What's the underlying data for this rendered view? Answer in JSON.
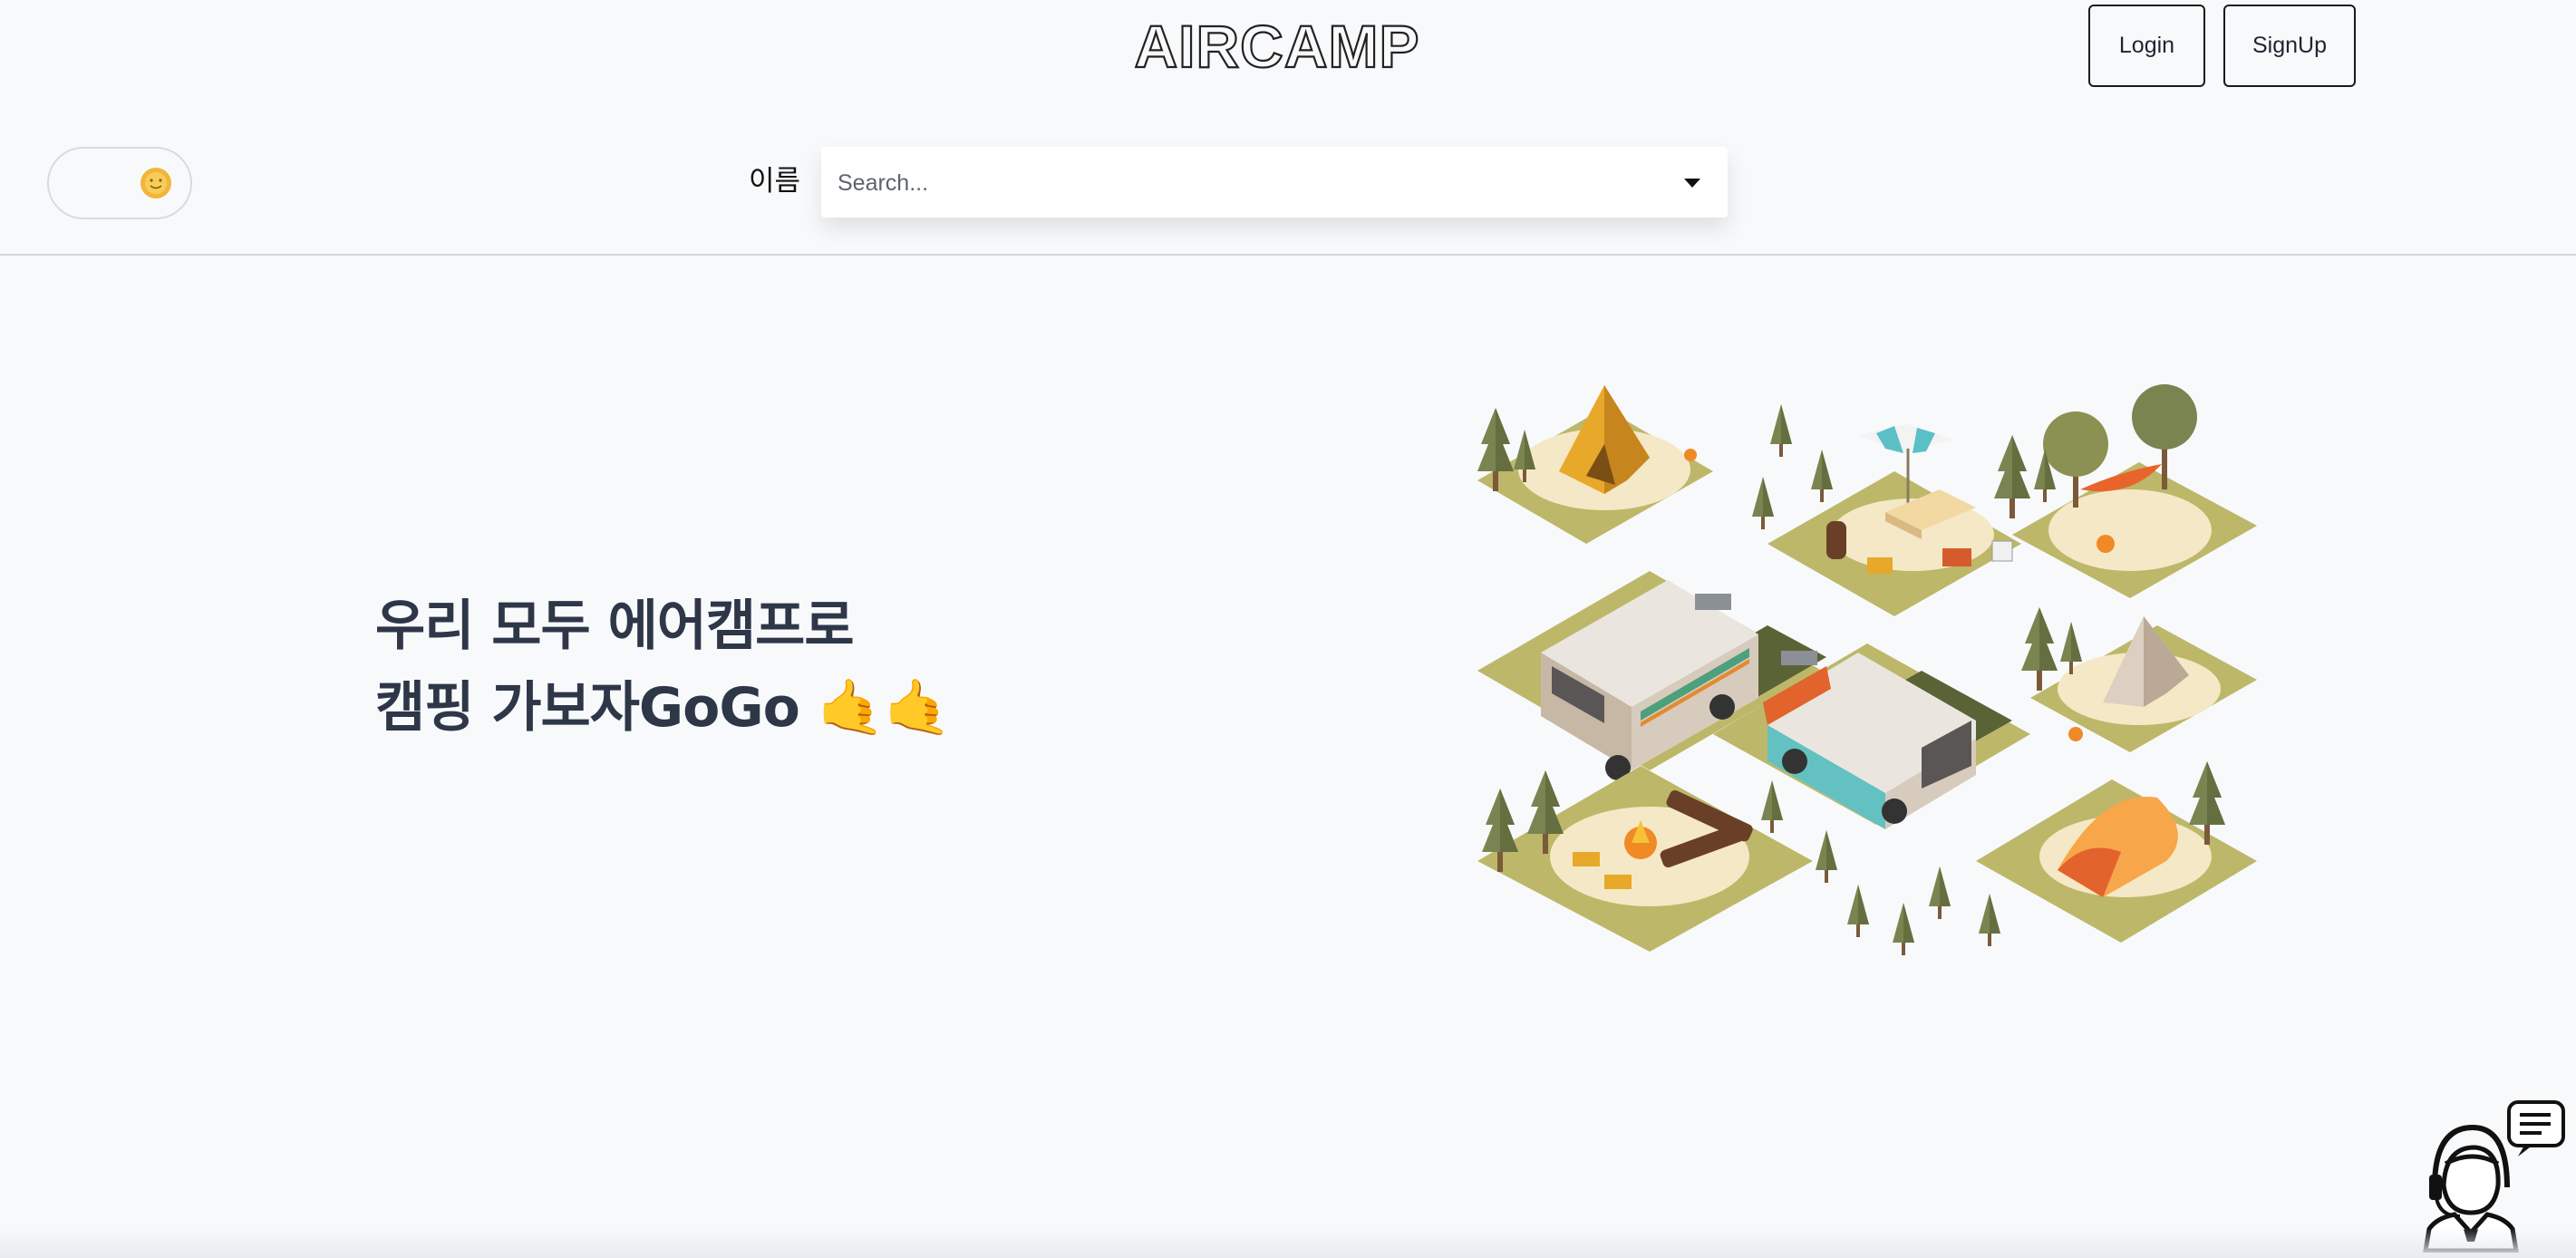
{
  "header": {
    "logo_text": "AIRCAMP",
    "login_label": "Login",
    "signup_label": "SignUp"
  },
  "theme_toggle": {
    "icon": "sun-icon",
    "state": "light"
  },
  "search": {
    "label": "이름",
    "placeholder": "Search...",
    "dropdown_icon": "caret-down-icon"
  },
  "hero": {
    "line1": "우리 모두 에어캠프로",
    "line2": "캠핑 가보자GoGo 🤙🤙",
    "illustration": "isometric-campsite-illustration"
  },
  "chat": {
    "icon": "customer-support-chat-icon"
  },
  "colors": {
    "background": "#f8f9fb",
    "heading": "#2d3748",
    "grass": "#bdb769",
    "sand": "#f5e8c6",
    "tent_yellow": "#e8a82a",
    "tent_orange": "#f38b3c",
    "tree": "#7c8450"
  }
}
